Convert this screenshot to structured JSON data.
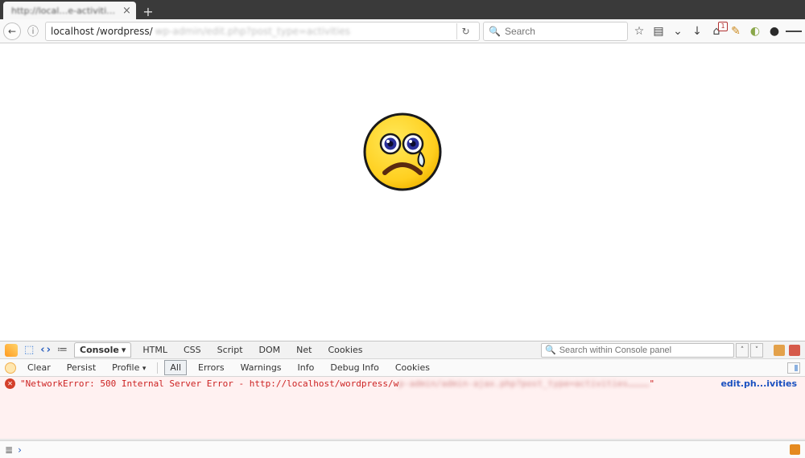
{
  "tab": {
    "title": "http://local…e-activities",
    "close_glyph": "×"
  },
  "nav": {
    "back_glyph": "←",
    "url_strong": "localhost",
    "url_path": "/wordpress/",
    "url_rest_blurred": "wp-admin/edit.php?post_type=activities",
    "refresh_glyph": "↻",
    "search_placeholder": "Search"
  },
  "toolbar_icons": [
    "star",
    "clipboard",
    "pocket",
    "download",
    "home",
    "extension",
    "puzzle",
    "globe",
    "menu"
  ],
  "devtools": {
    "panels": [
      "Console",
      "HTML",
      "CSS",
      "Script",
      "DOM",
      "Net",
      "Cookies"
    ],
    "active_panel": "Console",
    "dropdown_glyph": "▾",
    "search_placeholder": "Search within Console panel",
    "step_up": "˄",
    "step_down": "˅",
    "tool_buttons": [
      "Clear",
      "Persist",
      "Profile"
    ],
    "profile_dropdown": "▾",
    "filters": [
      "All",
      "Errors",
      "Warnings",
      "Info",
      "Debug Info",
      "Cookies"
    ],
    "active_filter": "All",
    "error": {
      "x": "✕",
      "msg_visible": "\"NetworkError: 500 Internal Server Error - http://localhost/wordpress/w",
      "msg_blurred": "p-admin/admin-ajax.php?post_type=activities…………",
      "msg_end": "\"",
      "source_link": "edit.ph...ivities"
    },
    "console_prompt": ">_",
    "page_icon": "≣"
  }
}
